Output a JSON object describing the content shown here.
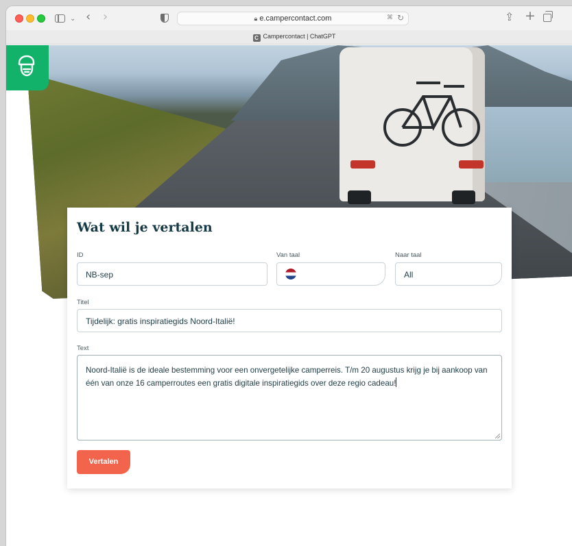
{
  "browser": {
    "url": "e.campercontact.com",
    "tab_title": "Campercontact | ChatGPT",
    "favicon_letter": "C"
  },
  "form": {
    "title": "Wat wil je vertalen",
    "id_label": "ID",
    "id_value": "NB-sep",
    "from_label": "Van taal",
    "from_flag": "netherlands-flag-icon",
    "to_label": "Naar taal",
    "to_value": "All",
    "title_label": "Titel",
    "title_value": "Tijdelijk: gratis inspiratiegids Noord-Italië!",
    "text_label": "Text",
    "text_value": "Noord-Italië is de ideale bestemming voor een onvergetelijke camperreis. T/m 20 augustus krijg je bij aankoop van één van onze 16 camperroutes een gratis digitale inspiratiegids over deze regio cadeau!",
    "submit_label": "Vertalen"
  },
  "colors": {
    "brand_green": "#12b26b",
    "title_color": "#163a44",
    "button_color": "#f2644c"
  }
}
